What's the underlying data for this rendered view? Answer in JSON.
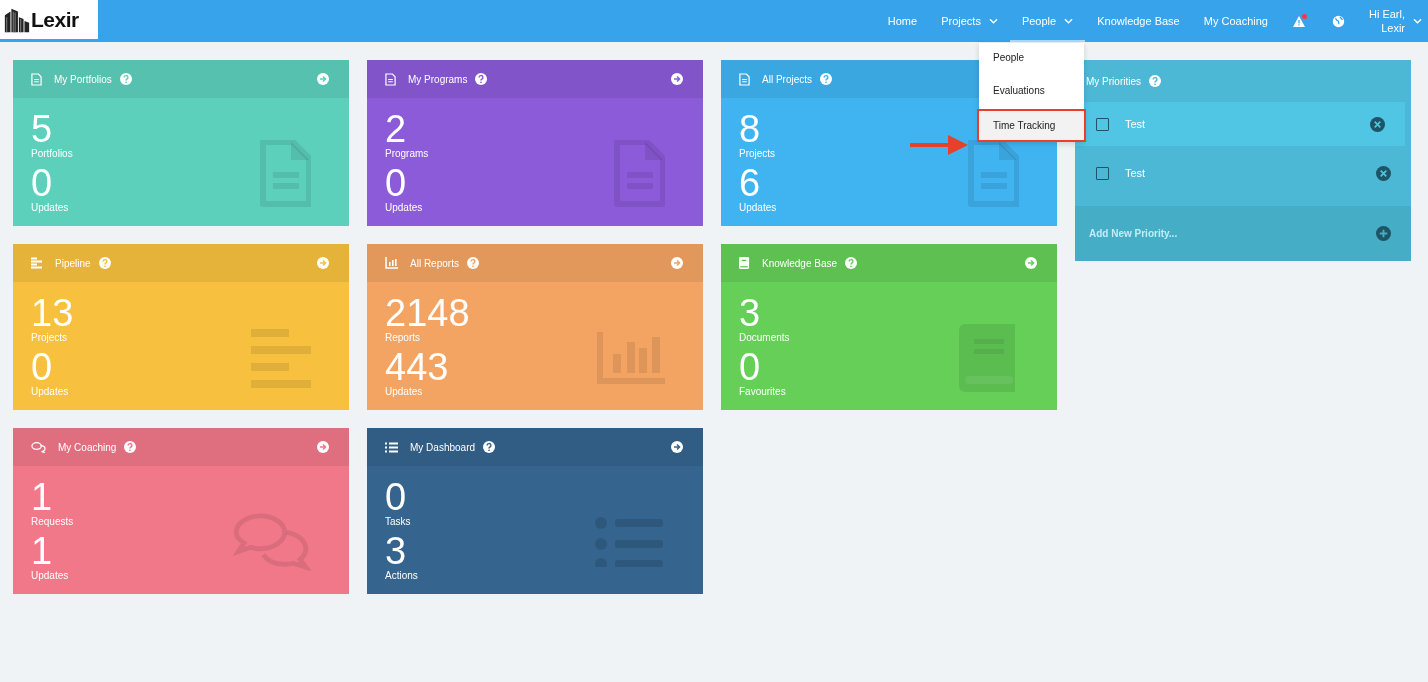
{
  "logo": {
    "text": "Lexir"
  },
  "nav": [
    {
      "label": "Home",
      "has_menu": false,
      "open": false
    },
    {
      "label": "Projects",
      "has_menu": true,
      "open": false
    },
    {
      "label": "People",
      "has_menu": true,
      "open": true
    },
    {
      "label": "Knowledge Base",
      "has_menu": false,
      "open": false
    },
    {
      "label": "My Coaching",
      "has_menu": false,
      "open": false
    }
  ],
  "alerts": {
    "unread": true
  },
  "user": {
    "line1": "Hi Earl,",
    "line2": "Lexir"
  },
  "dropdown": [
    {
      "label": "People",
      "annotated": false
    },
    {
      "label": "Evaluations",
      "annotated": false
    },
    {
      "label": "Time Tracking",
      "annotated": true
    }
  ],
  "cards": [
    {
      "title": "My Portfolios",
      "kind": "document",
      "color": "#5dd0bc",
      "stats": [
        {
          "value": "5",
          "label": "Portfolios"
        },
        {
          "value": "0",
          "label": "Updates"
        }
      ]
    },
    {
      "title": "My Programs",
      "kind": "document",
      "color": "#8c5bd9",
      "stats": [
        {
          "value": "2",
          "label": "Programs"
        },
        {
          "value": "0",
          "label": "Updates"
        }
      ]
    },
    {
      "title": "All Projects",
      "kind": "document",
      "color": "#40b4f1",
      "stats": [
        {
          "value": "8",
          "label": "Projects"
        },
        {
          "value": "6",
          "label": "Updates"
        }
      ]
    },
    {
      "title": "Pipeline",
      "kind": "lines",
      "color": "#f7c13f",
      "stats": [
        {
          "value": "13",
          "label": "Projects"
        },
        {
          "value": "0",
          "label": "Updates"
        }
      ]
    },
    {
      "title": "All Reports",
      "kind": "chart",
      "color": "#f4a462",
      "stats": [
        {
          "value": "2148",
          "label": "Reports"
        },
        {
          "value": "443",
          "label": "Updates"
        }
      ]
    },
    {
      "title": "Knowledge Base",
      "kind": "book",
      "color": "#65cf58",
      "stats": [
        {
          "value": "3",
          "label": "Documents"
        },
        {
          "value": "0",
          "label": "Favourites"
        }
      ]
    },
    {
      "title": "My Coaching",
      "kind": "chat",
      "color": "#f07888",
      "stats": [
        {
          "value": "1",
          "label": "Requests"
        },
        {
          "value": "1",
          "label": "Updates"
        }
      ]
    },
    {
      "title": "My Dashboard",
      "kind": "list",
      "color": "#35648e",
      "stats": [
        {
          "value": "0",
          "label": "Tasks"
        },
        {
          "value": "3",
          "label": "Actions"
        }
      ]
    }
  ],
  "priorities": {
    "title": "My Priorities",
    "items": [
      {
        "label": "Test",
        "checked": false,
        "highlighted": true
      },
      {
        "label": "Test",
        "checked": false,
        "highlighted": false
      }
    ],
    "add_placeholder": "Add New Priority..."
  }
}
